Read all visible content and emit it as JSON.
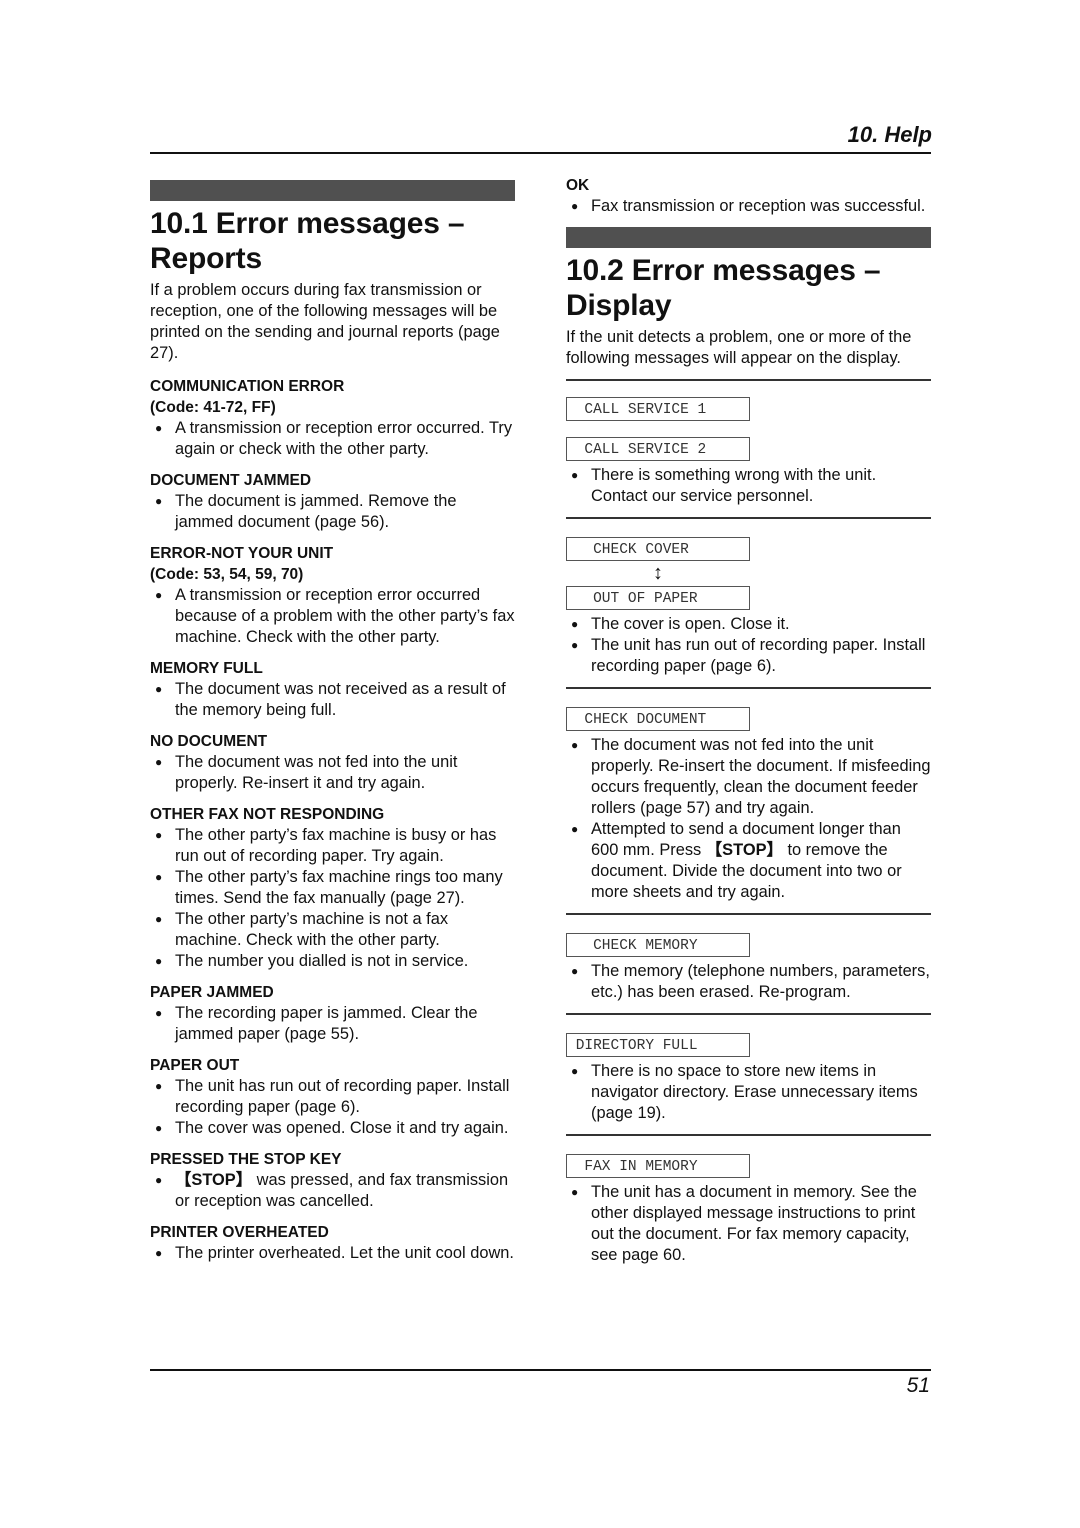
{
  "header": {
    "chapter": "10. Help"
  },
  "footer": {
    "page_number": "51"
  },
  "section_reports": {
    "title_line1": "10.1 Error messages –",
    "title_line2": "Reports",
    "intro": "If a problem occurs during fax transmission or reception, one of the following messages will be printed on the sending and journal reports (page 27).",
    "messages": [
      {
        "title": "COMMUNICATION ERROR",
        "code": "(Code: 41-72, FF)",
        "bullets": [
          "A transmission or reception error occurred. Try again or check with the other party."
        ]
      },
      {
        "title": "DOCUMENT JAMMED",
        "bullets": [
          "The document is jammed. Remove the jammed document (page 56)."
        ]
      },
      {
        "title": "ERROR-NOT YOUR UNIT",
        "code": "(Code: 53, 54, 59, 70)",
        "bullets": [
          "A transmission or reception error occurred because of a problem with the other party’s fax machine. Check with the other party."
        ]
      },
      {
        "title": "MEMORY FULL",
        "bullets": [
          "The document was not received as a result of the memory being full."
        ]
      },
      {
        "title": "NO DOCUMENT",
        "bullets": [
          "The document was not fed into the unit properly. Re-insert it and try again."
        ]
      },
      {
        "title": "OTHER FAX NOT RESPONDING",
        "bullets": [
          "The other party’s fax machine is busy or has run out of recording paper. Try again.",
          "The other party’s fax machine rings too many times. Send the fax manually (page 27).",
          "The other party’s machine is not a fax machine. Check with the other party.",
          "The number you dialled is not in service."
        ]
      },
      {
        "title": "PAPER JAMMED",
        "bullets": [
          "The recording paper is jammed. Clear the jammed paper (page 55)."
        ]
      },
      {
        "title": "PAPER OUT",
        "bullets": [
          "The unit has run out of recording paper. Install recording paper (page 6).",
          "The cover was opened. Close it and try again."
        ]
      },
      {
        "title": "PRESSED THE STOP KEY",
        "stop_key": "【STOP】",
        "bullets": [
          " was pressed, and fax transmission or reception was cancelled."
        ]
      },
      {
        "title": "PRINTER OVERHEATED",
        "bullets": [
          "The printer overheated. Let the unit cool down."
        ]
      }
    ],
    "ok": {
      "title": "OK",
      "bullets": [
        "Fax transmission or reception was successful."
      ]
    }
  },
  "section_display": {
    "title_line1": "10.2 Error messages –",
    "title_line2": "Display",
    "intro": "If the unit detects a problem, one or more of the following messages will appear on the display.",
    "arrow_icon": "↕",
    "groups": [
      {
        "lcd": [
          "  CALL SERVICE 1 ",
          "  CALL SERVICE 2 "
        ],
        "bullets": [
          "There is something wrong with the unit. Contact our service personnel."
        ]
      },
      {
        "lcd": [
          "   CHECK COVER   ",
          "   OUT OF PAPER  "
        ],
        "bullets": [
          "The cover is open. Close it.",
          "The unit has run out of recording paper. Install recording paper (page 6)."
        ]
      },
      {
        "lcd": [
          "  CHECK DOCUMENT "
        ],
        "bullets": [
          "The document was not fed into the unit properly. Re-insert the document. If misfeeding occurs frequently, clean the document feeder rollers (page 57) and try again.",
          "Attempted to send a document longer than 600 mm. Press ",
          " to remove the document. Divide the document into two or more sheets and try again."
        ],
        "stop_key": "【STOP】"
      },
      {
        "lcd": [
          "   CHECK MEMORY  "
        ],
        "bullets": [
          "The memory (telephone numbers, parameters, etc.) has been erased. Re-program."
        ]
      },
      {
        "lcd": [
          " DIRECTORY FULL  "
        ],
        "bullets": [
          "There is no space to store new items in navigator directory. Erase unnecessary items (page 19)."
        ]
      },
      {
        "lcd": [
          "  FAX IN MEMORY  "
        ],
        "bullets": [
          "The unit has a document in memory. See the other displayed message instructions to print out the document. For fax memory capacity, see page 60."
        ]
      }
    ]
  }
}
